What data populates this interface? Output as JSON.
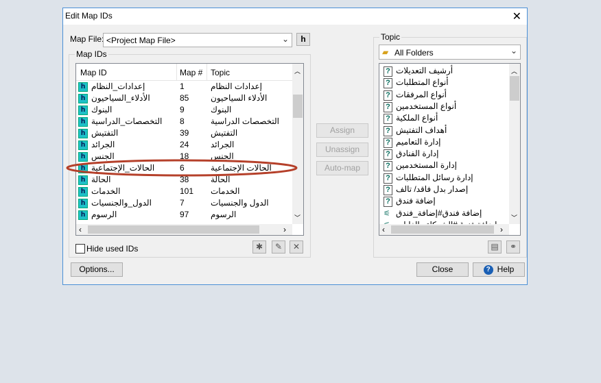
{
  "window": {
    "title": "Edit Map IDs"
  },
  "map_file": {
    "label": "Map File:",
    "value": "<Project Map File>"
  },
  "map_ids": {
    "group_label": "Map IDs",
    "columns": [
      "Map ID",
      "Map #",
      "Topic"
    ],
    "rows": [
      {
        "id": "إعدادات_النظام",
        "num": "1",
        "topic": "إعدادات النظام"
      },
      {
        "id": "الأدلاء_السياحيون",
        "num": "85",
        "topic": "الأدلاء السياحيون"
      },
      {
        "id": "البنوك",
        "num": "9",
        "topic": "البنوك"
      },
      {
        "id": "التخصصات_الدراسية",
        "num": "8",
        "topic": "التخصصات الدراسية"
      },
      {
        "id": "التفتيش",
        "num": "39",
        "topic": "التفتيش"
      },
      {
        "id": "الجرائد",
        "num": "24",
        "topic": "الجرائد"
      },
      {
        "id": "الجنس",
        "num": "18",
        "topic": "الجنس"
      },
      {
        "id": "الحالات_الإجتماعية",
        "num": "6",
        "topic": "الحالات الإجتماعية",
        "highlighted": true
      },
      {
        "id": "الحالة",
        "num": "38",
        "topic": "الحالة"
      },
      {
        "id": "الخدمات",
        "num": "101",
        "topic": "الخدمات"
      },
      {
        "id": "الدول_والجنسيات",
        "num": "7",
        "topic": "الدول والجنسيات"
      },
      {
        "id": "الرسوم",
        "num": "97",
        "topic": "الرسوم"
      }
    ],
    "hide_used_label": "Hide used IDs",
    "hide_used_checked": false
  },
  "actions": {
    "assign": "Assign",
    "unassign": "Unassign",
    "automap": "Auto-map"
  },
  "topic": {
    "group_label": "Topic",
    "folder": "All Folders",
    "items": [
      "أرشيف التعديلات",
      "أنواع المتطلبات",
      "أنواع المرفقات",
      "أنواع المستخدمين",
      "أنواع الملكية",
      "أهداف التفتيش",
      "إدارة التعاميم",
      "إدارة الفنادق",
      "إدارة المستخدمين",
      "إدارة رسائل المتطلبات",
      "إصدار بدل فاقد/ تالف",
      "إضافة فندق",
      "إضافة فندق#إضافة_فندق",
      "إضافة فندق#الشركاء والغايات"
    ]
  },
  "footer": {
    "options": "Options...",
    "close": "Close",
    "help": "Help"
  },
  "colors": {
    "highlight_ellipse": "#b5402a",
    "window_border": "#4a8fd6",
    "help_icon": "#1a5fb4"
  }
}
